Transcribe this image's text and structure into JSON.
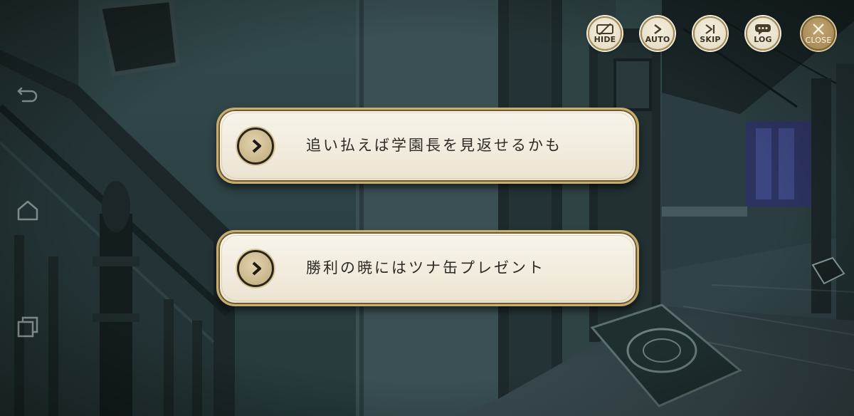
{
  "menu": {
    "hide_label": "HIDE",
    "auto_label": "AUTO",
    "skip_label": "SKIP",
    "log_label": "LOG",
    "close_label": "CLOSE"
  },
  "choices": [
    {
      "text": "追い払えば学園長を見返せるかも"
    },
    {
      "text": "勝利の暁にはツナ缶プレゼント"
    }
  ],
  "icons": {
    "hide": "eye-slash-icon",
    "auto": "play-chevron-icon",
    "skip": "skip-icon",
    "log": "chat-bubble-icon",
    "close": "close-x-icon",
    "choice": "play-arrow-icon",
    "nav_back": "back-icon",
    "nav_home": "home-icon",
    "nav_recents": "recents-icon"
  },
  "colors": {
    "button_cream": "#f1ebdd",
    "button_border_gold": "#c7ad6e",
    "close_gold": "#a88b55",
    "text_dark": "#2e2a24",
    "scene_teal": "#2a3d40"
  }
}
